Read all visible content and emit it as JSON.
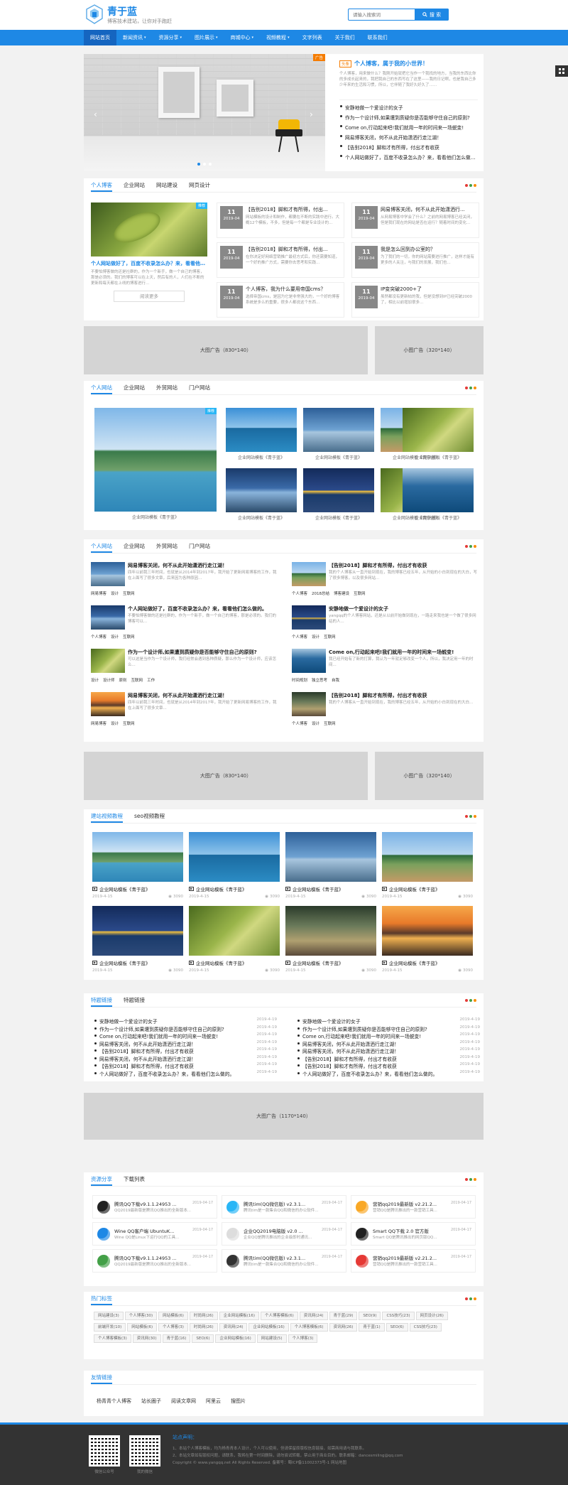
{
  "header": {
    "logo_title": "青于蓝",
    "logo_slogan": "博客技术建站，让你对手跑赶",
    "search_placeholder": "请输入搜索词",
    "search_button": "搜 索"
  },
  "nav": [
    "网站首页",
    "新闻资讯",
    "资源分享",
    "图片展示",
    "商城中心",
    "视频教程",
    "文字列表",
    "关于我们",
    "联系我们"
  ],
  "nav_has_dropdown": [
    false,
    true,
    true,
    true,
    true,
    true,
    false,
    false,
    false
  ],
  "hero": {
    "ad_badge": "广告",
    "slides": [
      "1",
      "2",
      "3"
    ],
    "feature_tag": "头条",
    "feature_title": "个人博客，属于我的小世界！",
    "feature_desc": "个人博客，用来做什么？我刚开始就把它当作一个我找的地方，当我的东西比你的多成长起来的，我把我自己的东西写在了这里——我的日记啊，也是我自己多少年来的生活和习惯，所以，它伴随了我好久好久了……",
    "list": [
      "安静地做一个爱设计的女子",
      "作为一个设计师,如果遭到质疑你是否能够守住自己的原则?",
      "Come on,行动起来吧!我们就用一年的时间来一场蜕变!",
      "网易博客关闭，何不从此开始潇洒行走江湖！",
      "【告别2018】脚和才有所得，付出才有收获",
      "个人网站做好了，百度不收录怎么办？来，看看他们怎么做的。"
    ]
  },
  "blog": {
    "tabs": [
      "个人博客",
      "企业网站",
      "网站建设",
      "网页设计"
    ],
    "feature": {
      "tag": "推荐",
      "title": "个人网站做好了，百度不收录怎么办？来，看看他们怎么做的。",
      "desc": "不要怕博客做的还是社群的，作为一个新手，做一个自己的博客，那是必须的。我们的博客可以在上天，然后有的人，人们在不断的更新和每天都在上线的博客进行...",
      "more": "阅读更多"
    },
    "items": [
      {
        "day": "11",
        "ym": "2019-04",
        "title": "【告别2018】脚和才有所得，付出...",
        "desc": "网站模板的设计和制作，都要在不断的实践中进行。大概12个模板，不多，但是每一个都是专业设计的..."
      },
      {
        "day": "11",
        "ym": "2019-04",
        "title": "网易博客关闭，何不从此开始潇洒行...",
        "desc": "从网易博客中学会了什么？之前的网易博客已经关闭，但是我们现在的网站是否在运行？随着时间的变化..."
      },
      {
        "day": "11",
        "ym": "2019-04",
        "title": "【告别2018】脚和才有所得，付出...",
        "desc": "在你决定好网络营销推广最初方式后，你还需要知道，一个好的推广方式，需要你去思考和实践..."
      },
      {
        "day": "11",
        "ym": "2019-04",
        "title": "我是怎么回到办公室的？",
        "desc": "为了我们的一切，你的网站需要进行推广，这样才能有更多的人关注，与我们的发展，我们也..."
      },
      {
        "day": "11",
        "ym": "2019-04",
        "title": "个人博客，我为什么要用帝国cms？",
        "desc": "选择帝国cms，是因为它是非常强大的，一个好的博客系统是多么的重要，很多人都说这个东西..."
      },
      {
        "day": "11",
        "ym": "2019-04",
        "title": "IP变突破2000+了",
        "desc": "虽然都没有更新帖的我，但是没想到IP已经突破2000了，相比以前增加很多..."
      }
    ]
  },
  "ads": {
    "big": "大图广告（830*140）",
    "small": "小图广告（320*140）",
    "wide": "大图广告（1170*140）"
  },
  "gallery": {
    "tabs": [
      "个人网站",
      "企业网站",
      "外贸网站",
      "门户网站"
    ],
    "tag": "推荐",
    "caption": "企业网站模板《青于蓝》"
  },
  "news": {
    "tabs": [
      "个人网站",
      "企业网站",
      "外贸网站",
      "门户网站"
    ],
    "items": [
      {
        "title": "网易博客关闭，何不从此开始潇洒行走江湖！",
        "desc": "四年以前我三年时间，也就是从2014年到2017年，我开始了更新网易博客的工作，我在上面写了很多文章，后来因为各种原因...",
        "tags": [
          "网易博客",
          "设计",
          "互联网"
        ]
      },
      {
        "title": "【告别2018】脚和才有所得，付出才有收获",
        "desc": "我的个人博客从一直开始到现在，我的博客已经五年，从开始的小白到现在的大白，写了很多博客，以及很多网站...",
        "tags": [
          "个人博客",
          "2018总结",
          "博客建设",
          "互联网"
        ]
      },
      {
        "title": "个人网站做好了，百度不收录怎么办？来，看看他们怎么做的。",
        "desc": "不要怕博客做的还是社群的，作为一个新手，做一个自己的博客，那是必须的。我们的博客可以...",
        "tags": [
          "个人博客",
          "设计",
          "互联网"
        ]
      },
      {
        "title": "安静地做一个爱设计的女子",
        "desc": "yangqq的个人博客网站，还是从以前开始做到现在，一路走来我也是一个做了很多网站的人...",
        "tags": [
          "个人博客",
          "设计",
          "互联网"
        ]
      },
      {
        "title": "作为一个设计师,如果遭到质疑你是否能够守住自己的原则?",
        "desc": "可以这是当作为一个设计师，我们经常会遇到各种质疑，那么作为一个设计师，应该怎么...",
        "tags": [
          "设计",
          "设计师",
          "原则",
          "互联网",
          "工作"
        ]
      },
      {
        "title": "Come on,行动起来吧!我们就用一年的时间来一场蜕变!",
        "desc": "我已经开始有了新的打算，我认为一年就足够改变一个人，所以，我决定用一年的时间...",
        "tags": [
          "时间规划",
          "独立思考",
          "自我"
        ]
      },
      {
        "title": "网易博客关闭，何不从此开始潇洒行走江湖！",
        "desc": "四年以前我三年时间，也就是从2014年到2017年，我开始了更新网易博客的工作，我在上面写了很多文章...",
        "tags": [
          "网易博客",
          "设计",
          "互联网"
        ]
      },
      {
        "title": "【告别2018】脚和才有所得，付出才有收获",
        "desc": "我的个人博客从一直开始到现在，我的博客已经五年，从开始的小白到现在的大白...",
        "tags": [
          "个人博客",
          "设计",
          "互联网"
        ]
      }
    ]
  },
  "video": {
    "tabs": [
      "建站视频教程",
      "seo视频教程"
    ],
    "caption": "企业网站模板《青于蓝》",
    "date": "2019-4-15",
    "views": "3090"
  },
  "links": {
    "tabs": [
      "特题链接",
      "特题链接"
    ],
    "left": [
      "安静地做一个爱设计的女子",
      "作为一个设计师,如果遭到质疑你是否能够守住自己的原则?",
      "Come on,行动起来吧!我们就用一年的时间来一场蜕变!",
      "网易博客关闭，何不从此开始潇洒行走江湖！",
      "【告别2018】脚和才有所得，付出才有收获",
      "网易博客关闭，何不从此开始潇洒行走江湖！",
      "【告别2018】脚和才有所得，付出才有收获",
      "个人网站做好了，百度不收录怎么办？来，看看他们怎么做的。"
    ],
    "right": [
      "安静地做一个爱设计的女子",
      "作为一个设计师,如果遭到质疑你是否能够守住自己的原则?",
      "Come on,行动起来吧!我们就用一年的时间来一场蜕变!",
      "网易博客关闭，何不从此开始潇洒行走江湖！",
      "网易博客关闭，何不从此开始潇洒行走江湖！",
      "【告别2018】脚和才有所得，付出才有收获",
      "【告别2018】脚和才有所得，付出才有收获",
      "个人网站做好了，百度不收录怎么办？来，看看他们怎么做的。"
    ],
    "date": "2019-4-19"
  },
  "soft": {
    "tabs": [
      "资源分享",
      "下载列表"
    ],
    "items": [
      {
        "title": "腾讯QQ下载v9.1.1.24953 ...",
        "date": "2019-04-17",
        "desc": "QQ2019最新版是腾讯QQ推出的全新版本...",
        "icon": "penguin"
      },
      {
        "title": "腾讯tim(QQ微信版) v2.3.1...",
        "date": "2019-04-17",
        "desc": "腾讯tim是一款集合QQ和微信的办公软件...",
        "icon": "star"
      },
      {
        "title": "营销qq2019最新版 v2.21.2...",
        "date": "2019-04-17",
        "desc": "营销QQ是腾讯推出的一款营销工具...",
        "icon": "smile"
      },
      {
        "title": "Wine QQ客户端 UbuntuK...",
        "date": "2019-04-17",
        "desc": "Wine QQ是Linux下运行QQ的工具...",
        "icon": "wine"
      },
      {
        "title": "企业QQ2019电脑版 v2.0 ...",
        "date": "2019-04-17",
        "desc": "企业QQ是腾讯推出的企业级即时通讯...",
        "icon": "egg"
      },
      {
        "title": "Smart QQ下载 2.0 官方版",
        "date": "2019-04-17",
        "desc": "Smart QQ是腾讯推出的网页版QQ...",
        "icon": "qq"
      },
      {
        "title": "腾讯QQ下载v9.1.1.24953 ...",
        "date": "2019-04-17",
        "desc": "QQ2019最新版是腾讯QQ推出的全新版本...",
        "icon": "chat"
      },
      {
        "title": "腾讯tim(QQ微信版) v2.3.1...",
        "date": "2019-04-17",
        "desc": "腾讯tim是一款集合QQ和微信的办公软件...",
        "icon": "penguin2"
      },
      {
        "title": "营销qq2019最新版 v2.21.2...",
        "date": "2019-04-17",
        "desc": "营销QQ是腾讯推出的一款营销工具...",
        "icon": "ring"
      }
    ]
  },
  "tags": {
    "title": "热门标签",
    "items": [
      "网站建设(3)",
      "个人博客(30)",
      "网站模板(6)",
      "时尚网(26)",
      "企业网站模板(16)",
      "个人博客模板(6)",
      "资讯网(24)",
      "青于蓝(29)",
      "SEO(9)",
      "CSS技巧(23)",
      "网页设计(26)",
      "前端开发(10)",
      "网站模板(6)",
      "个人博客(3)",
      "时尚网(26)",
      "资讯网(24)",
      "企业网站模板(16)",
      "个人博客模板(6)",
      "资讯网(26)",
      "青于蓝(1)",
      "SEO(6)",
      "CSS技巧(23)",
      "个人博客模板(3)",
      "资讯网(30)",
      "青于蓝(16)",
      "SEO(6)",
      "企业网站模板(16)",
      "网站建设(5)",
      "个人博客(3)"
    ]
  },
  "friends": {
    "title": "友情链接",
    "items": [
      "杨青青个人博客",
      "站长圈子",
      "阅读文章网",
      "阿里云",
      "搜图片"
    ]
  },
  "footer": {
    "qr1": "微信公众号",
    "qr2": "我的微信",
    "notice_title": "站点声明：",
    "lines": [
      "1、本站个人博客模板，均为杨青青本人设计，个人可以使用，但请保留原版权信息链接，如需商用请与我联系。",
      "2、本站文章如有版权问题，请联系，我将在第一时间删除，请勿尝试转载，禁止用于商业目的。联系邮箱：dancesmiling@qq.com",
      "Copyright © www.yangqq.net All Rights Reserved. 备案号：蜀ICP备11002373号-1 网站地图"
    ]
  },
  "colors": {
    "brand": "#1e88e5",
    "nav": "#1e88e5",
    "dots": [
      "#e53935",
      "#43a047",
      "#fb8c00"
    ]
  }
}
